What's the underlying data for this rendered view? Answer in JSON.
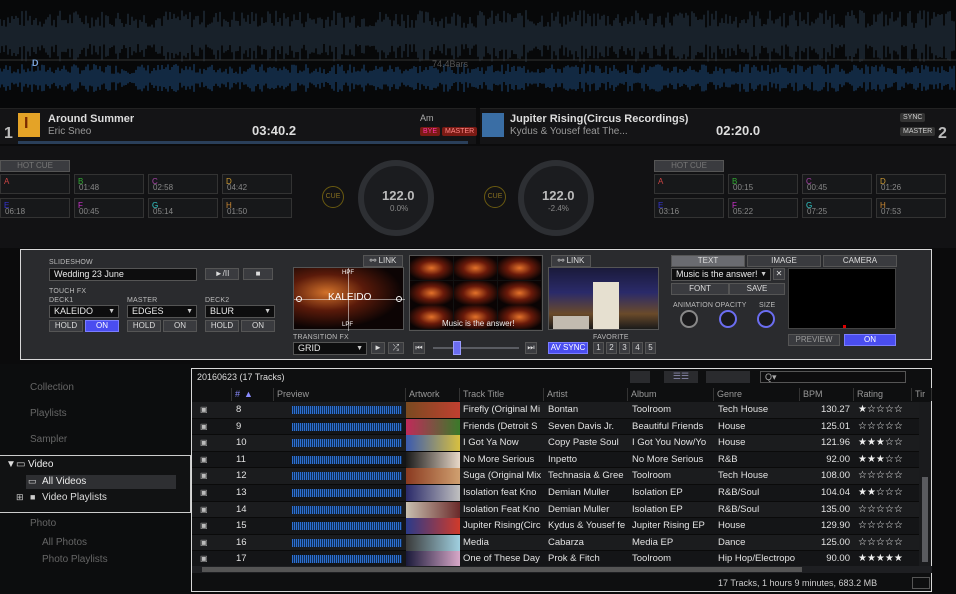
{
  "waveform": {
    "marker": "D",
    "bars_label": "74.4Bars"
  },
  "deck1": {
    "number": "1",
    "title": "Around Summer",
    "artist": "Eric Sneo",
    "time": "03:40.2",
    "key": "Am",
    "badges": [
      "BYE",
      "MASTER"
    ],
    "bpm": "122.0",
    "pitch": "0.0%",
    "pads": [
      {
        "key": "A",
        "time": ""
      },
      {
        "key": "B",
        "time": "01:48"
      },
      {
        "key": "C",
        "time": "02:58"
      },
      {
        "key": "D",
        "time": "04:42"
      },
      {
        "key": "E",
        "time": "06:18"
      },
      {
        "key": "F",
        "time": "00:45"
      },
      {
        "key": "G",
        "time": "05:14"
      },
      {
        "key": "H",
        "time": "01:50"
      }
    ]
  },
  "deck2": {
    "number": "2",
    "title": "Jupiter Rising(Circus Recordings)",
    "artist": "Kydus & Yousef feat The...",
    "time": "02:20.0",
    "badges": [
      "SYNC",
      "MASTER"
    ],
    "bpm": "122.0",
    "pitch": "-2.4%",
    "pads": [
      {
        "key": "A",
        "time": ""
      },
      {
        "key": "B",
        "time": "00:15"
      },
      {
        "key": "C",
        "time": "00:45"
      },
      {
        "key": "D",
        "time": "01:26"
      },
      {
        "key": "E",
        "time": "03:16"
      },
      {
        "key": "F",
        "time": "05:22"
      },
      {
        "key": "G",
        "time": "07:25"
      },
      {
        "key": "H",
        "time": "07:53"
      }
    ]
  },
  "hot_cue_label": "HOT CUE",
  "cue_label": "CUE",
  "video_panel": {
    "slideshow_label": "SLIDESHOW",
    "slideshow_value": "Wedding 23 June",
    "play_pause": "►/II",
    "stop": "■",
    "touch_fx_label": "TOUCH FX",
    "deck1_label": "DECK1",
    "master_label": "MASTER",
    "deck2_label": "DECK2",
    "deck1_fx": "KALEIDO",
    "master_fx": "EDGES",
    "deck2_fx": "BLUR",
    "hold": "HOLD",
    "on": "ON",
    "link": "LINK",
    "kaleido_overlay": "KALEIDO",
    "hpf": "HPF",
    "lpf": "LPF",
    "transition_label": "TRANSITION FX",
    "transition_value": "GRID",
    "caption": "Music is the answer!",
    "av_sync": "AV SYNC",
    "favorite_label": "FAVORITE",
    "favorites": [
      "1",
      "2",
      "3",
      "4",
      "5"
    ],
    "tabs": [
      "TEXT",
      "IMAGE",
      "CAMERA"
    ],
    "text_value": "Music is the answer!",
    "font_btn": "FONT",
    "save_btn": "SAVE",
    "animation_label": "ANIMATION",
    "opacity_label": "OPACITY",
    "size_label": "SIZE",
    "preview_btn": "PREVIEW",
    "on_btn": "ON"
  },
  "tree": {
    "collection": "Collection",
    "playlists": "Playlists",
    "sampler": "Sampler",
    "video": "Video",
    "all_videos": "All Videos",
    "video_playlists": "Video Playlists",
    "photo": "Photo",
    "all_photos": "All Photos",
    "photo_playlists": "Photo Playlists"
  },
  "browser": {
    "header": "20160623 (17 Tracks)",
    "search_placeholder": "Q▾",
    "columns": [
      "#",
      "Preview",
      "Artwork",
      "Track Title",
      "Artist",
      "Album",
      "Genre",
      "BPM",
      "Rating",
      "Tir"
    ],
    "footer": "17 Tracks, 1 hours 9 minutes, 683.2 MB",
    "rows": [
      {
        "n": "8",
        "title": "Firefly (Original Mi",
        "artist": "Bontan",
        "album": "Toolroom",
        "genre": "Tech House",
        "bpm": "130.27",
        "rating": 1
      },
      {
        "n": "9",
        "title": "Friends (Detroit S",
        "artist": "Seven Davis Jr.",
        "album": "Beautiful Friends",
        "genre": "House",
        "bpm": "125.01",
        "rating": 0
      },
      {
        "n": "10",
        "title": "I Got Ya Now",
        "artist": "Copy Paste Soul",
        "album": "I Got You Now/Yo",
        "genre": "House",
        "bpm": "121.96",
        "rating": 3
      },
      {
        "n": "11",
        "title": "No More Serious",
        "artist": "Inpetto",
        "album": "No More Serious",
        "genre": "R&B",
        "bpm": "92.00",
        "rating": 3
      },
      {
        "n": "12",
        "title": "Suga (Original Mix",
        "artist": "Technasia & Gree",
        "album": "Toolroom",
        "genre": "Tech House",
        "bpm": "108.00",
        "rating": 0
      },
      {
        "n": "13",
        "title": "Isolation feat Kno",
        "artist": "Demian Muller",
        "album": "Isolation EP",
        "genre": "R&B/Soul",
        "bpm": "104.04",
        "rating": 2
      },
      {
        "n": "14",
        "title": "Isolation Feat Kno",
        "artist": "Demian Muller",
        "album": "Isolation EP",
        "genre": "R&B/Soul",
        "bpm": "135.00",
        "rating": 0
      },
      {
        "n": "15",
        "title": "Jupiter Rising(Circ",
        "artist": "Kydus & Yousef fe",
        "album": "Jupiter Rising EP",
        "genre": "House",
        "bpm": "129.90",
        "rating": 0
      },
      {
        "n": "16",
        "title": "Media",
        "artist": "Cabarza",
        "album": "Media EP",
        "genre": "Dance",
        "bpm": "125.00",
        "rating": 0
      },
      {
        "n": "17",
        "title": "One of These Day",
        "artist": "Prok & Fitch",
        "album": "Toolroom",
        "genre": "Hip Hop/Electropo",
        "bpm": "90.00",
        "rating": 5
      }
    ]
  },
  "colors": {
    "accent": "#4a4df0",
    "waveform": "#3a7bd5",
    "deck_badge": "#c0392b"
  }
}
